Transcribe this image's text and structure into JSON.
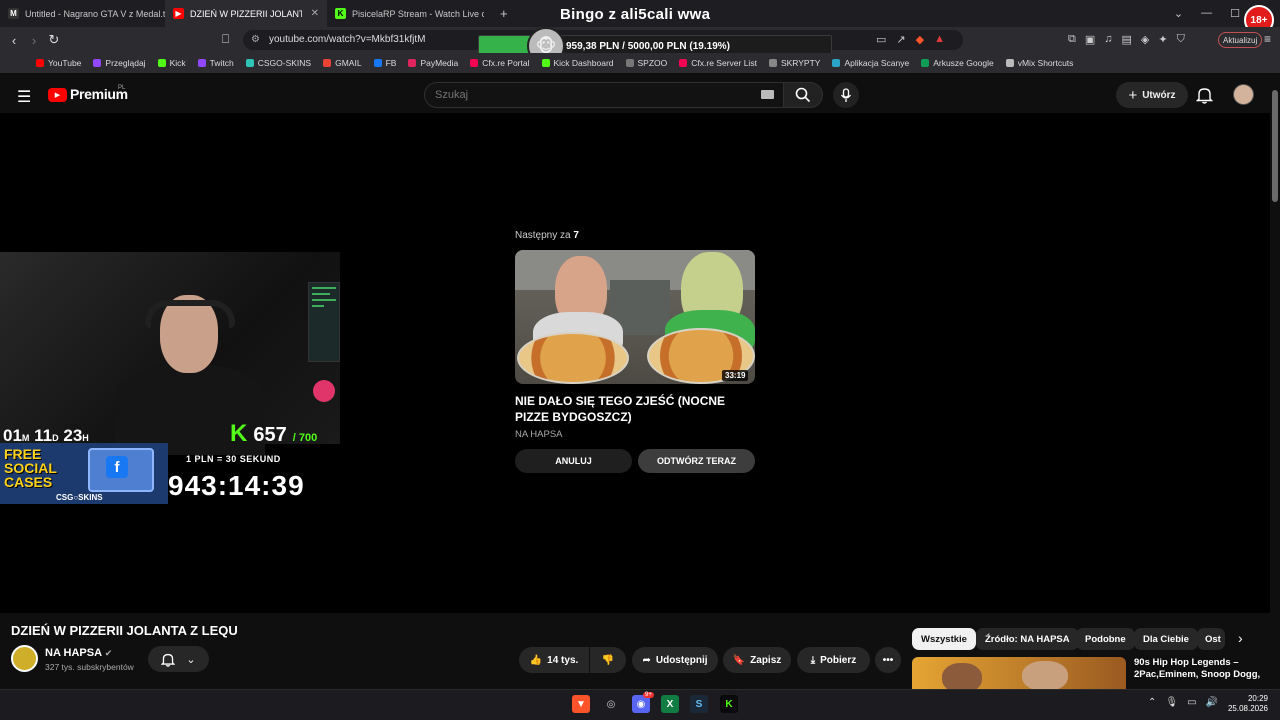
{
  "browser": {
    "tabs": [
      {
        "label": "Untitled - Nagrano GTA V z Medal.tv",
        "icon": "medal-icon"
      },
      {
        "label": "DZIEŃ W PIZZERII JOLANTA Z",
        "icon": "youtube-icon"
      },
      {
        "label": "PisicelaRP Stream - Watch Live on Ki",
        "icon": "kick-icon"
      }
    ],
    "new_tab": "+",
    "url": "youtube.com/watch?v=Mkbf31kfjtM",
    "update_button": "Aktualizuj",
    "bookmarks": [
      {
        "label": "YouTube",
        "color": "#ff0000"
      },
      {
        "label": "Przeglądaj",
        "color": "#9146ff"
      },
      {
        "label": "Kick",
        "color": "#53fc18"
      },
      {
        "label": "Twitch",
        "color": "#9146ff"
      },
      {
        "label": "CSGO-SKINS",
        "color": "#2ec4b6"
      },
      {
        "label": "GMAIL",
        "color": "#ea4335"
      },
      {
        "label": "FB",
        "color": "#1877f2"
      },
      {
        "label": "PayMedia",
        "color": "#e0245e"
      },
      {
        "label": "Cfx.re Portal",
        "color": "#f40552"
      },
      {
        "label": "Kick Dashboard",
        "color": "#53fc18"
      },
      {
        "label": "SPZOO",
        "color": "#777777"
      },
      {
        "label": "Cfx.re Server List",
        "color": "#f40552"
      },
      {
        "label": "SKRYPTY",
        "color": "#888888"
      },
      {
        "label": "Aplikacja Scanye",
        "color": "#2ba3c6"
      },
      {
        "label": "Arkusze Google",
        "color": "#0f9d58"
      },
      {
        "label": "vMix Shortcuts",
        "color": "#bbbbbb"
      }
    ]
  },
  "overlay": {
    "title": "Bingo z ali5cali wwa",
    "donation_text": "959,38 PLN / 5000,00 PLN  (19.19%)",
    "donation_progress": 0.1919,
    "age_badge": "18+",
    "countdown": {
      "m": "01",
      "m_unit": "M",
      "d": "11",
      "d_unit": "D",
      "h": "23",
      "h_unit": "H"
    },
    "kick_count": "657",
    "kick_goal": "/ 700",
    "promo_line1": "FREE",
    "promo_line2": "SOCIAL",
    "promo_line3": "CASES",
    "promo_brand": "CSG○SKINS",
    "rate": "1 PLN = 30 SEKUND",
    "timer": "943:14:39"
  },
  "youtube": {
    "logo": "Premium",
    "logo_region": "PL",
    "search_placeholder": "Szukaj",
    "create_label": "Utwórz",
    "next_label": "Następny za",
    "next_seconds": "7",
    "next_video_title": "NIE DAŁO SIĘ TEGO ZJEŚĆ (NOCNE PIZZE BYDGOSZCZ)",
    "next_video_channel": "NA HAPSA",
    "next_video_duration": "33:19",
    "cancel_label": "ANULUJ",
    "play_now_label": "ODTWÓRZ TERAZ",
    "video_title": "DZIEŃ W PIZZERII JOLANTA Z LEQU",
    "channel_name": "NA HAPSA",
    "subscribers": "327 tys. subskrybentów",
    "likes": "14 tys.",
    "share": "Udostępnij",
    "save": "Zapisz",
    "download": "Pobierz",
    "chips": [
      "Wszystkie",
      "Źródło: NA HAPSA",
      "Podobne",
      "Dla Ciebie",
      "Ost"
    ],
    "recommended_title": "90s Hip Hop Legends – 2Pac,Eminem, Snoop Dogg,"
  },
  "taskbar": {
    "time": "20:29",
    "date": "25.08.2026",
    "discord_badge": "9+"
  }
}
